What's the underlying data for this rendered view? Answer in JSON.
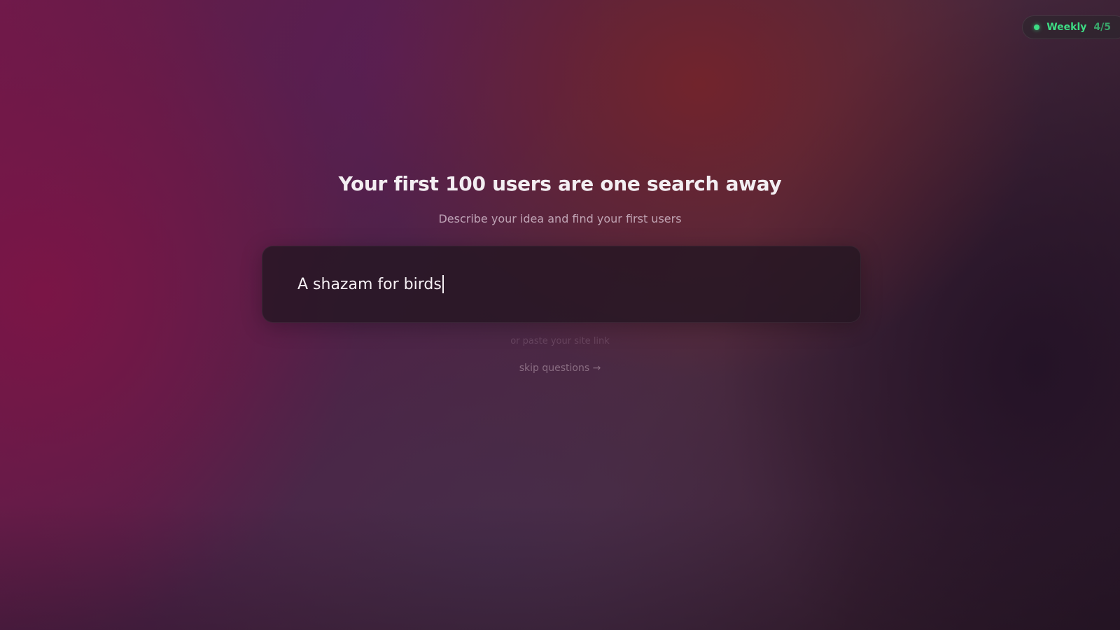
{
  "badge": {
    "label": "Weekly",
    "count": "4/5",
    "status_color": "#3ddc84"
  },
  "hero": {
    "title": "Your first 100 users are one search away",
    "subtitle": "Describe your idea and find your first users"
  },
  "search": {
    "value": "A shazam for birds"
  },
  "hint": {
    "text": "or paste your site link"
  },
  "skip": {
    "label": "skip questions",
    "arrow": "→"
  }
}
